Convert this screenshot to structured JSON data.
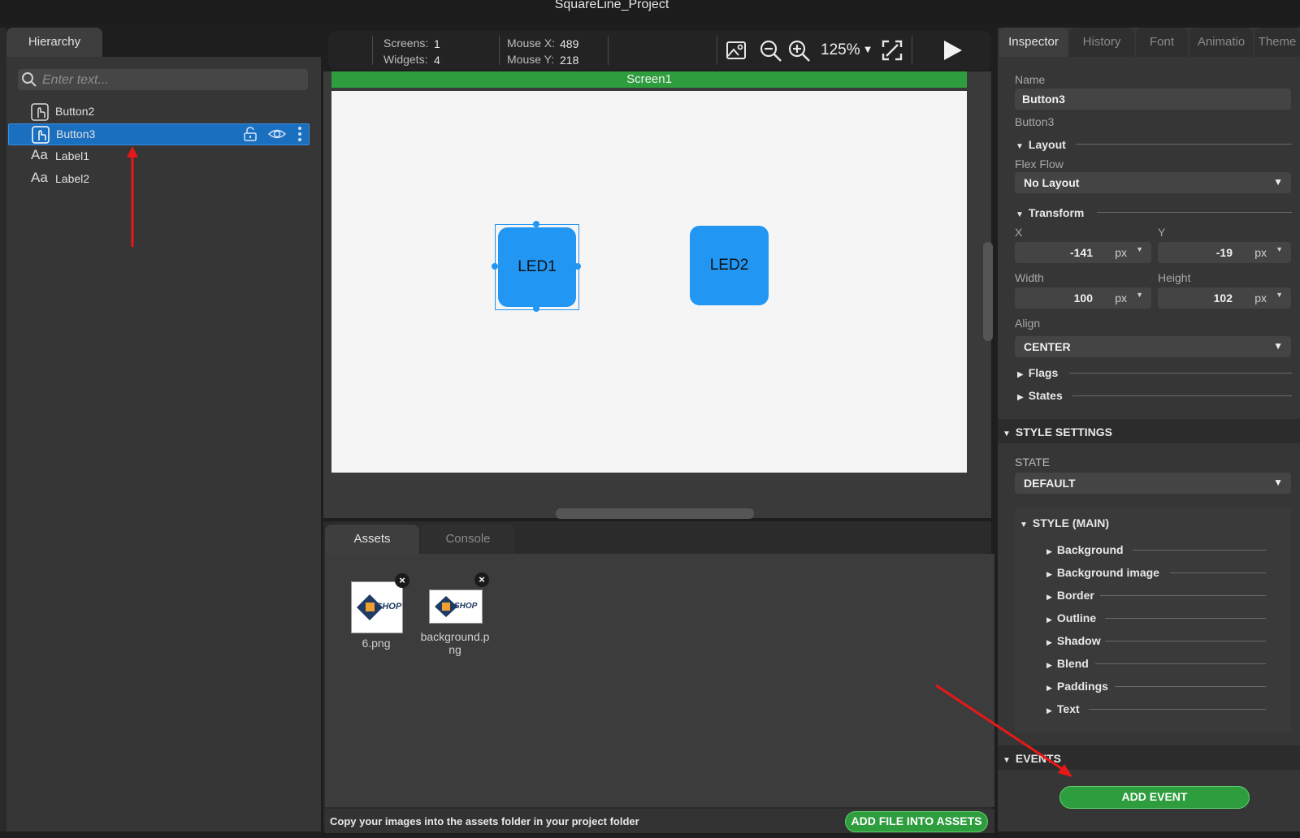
{
  "window": {
    "title": "SquareLine_Project"
  },
  "hierarchy": {
    "tab_label": "Hierarchy",
    "search_placeholder": "Enter text...",
    "items": [
      {
        "label": "Button2",
        "type": "button"
      },
      {
        "label": "Button3",
        "type": "button",
        "selected": true
      },
      {
        "label": "Label1",
        "type": "label"
      },
      {
        "label": "Label2",
        "type": "label"
      }
    ],
    "label_glyph": "Aa"
  },
  "toolbar": {
    "screens_label": "Screens:",
    "screens_value": "1",
    "widgets_label": "Widgets:",
    "widgets_value": "4",
    "mousex_label": "Mouse X:",
    "mousex_value": "489",
    "mousey_label": "Mouse Y:",
    "mousey_value": "218",
    "zoom": "125%"
  },
  "canvas": {
    "screen_name": "Screen1",
    "buttons": [
      {
        "label": "LED1"
      },
      {
        "label": "LED2"
      }
    ]
  },
  "assets": {
    "tabs": [
      {
        "label": "Assets",
        "active": true
      },
      {
        "label": "Console",
        "active": false
      }
    ],
    "items": [
      {
        "name": "6.png"
      },
      {
        "name": "background.p ng"
      }
    ],
    "thumb_text": "SHOP",
    "footer_message": "Copy your images into the assets folder in your project folder",
    "add_file_label": "ADD FILE INTO ASSETS"
  },
  "inspector": {
    "tabs": [
      "Inspector",
      "History",
      "Font",
      "Animatio",
      "Theme"
    ],
    "name_label": "Name",
    "name_value": "Button3",
    "type_label": "Button3",
    "layout": {
      "title": "Layout",
      "flex_flow_label": "Flex Flow",
      "flex_flow_value": "No Layout"
    },
    "transform": {
      "title": "Transform",
      "x_label": "X",
      "x_value": "-141",
      "x_unit": "px",
      "y_label": "Y",
      "y_value": "-19",
      "y_unit": "px",
      "width_label": "Width",
      "width_value": "100",
      "width_unit": "px",
      "height_label": "Height",
      "height_value": "102",
      "height_unit": "px",
      "align_label": "Align",
      "align_value": "CENTER"
    },
    "flags_label": "Flags",
    "states_label": "States",
    "style_settings": {
      "title": "STYLE SETTINGS",
      "state_label": "STATE",
      "state_value": "DEFAULT",
      "style_main_title": "STYLE (MAIN)",
      "items": [
        "Background",
        "Background image",
        "Border",
        "Outline",
        "Shadow",
        "Blend",
        "Paddings",
        "Text"
      ]
    },
    "events": {
      "title": "EVENTS",
      "add_label": "ADD EVENT"
    }
  },
  "colors": {
    "accent": "#2196f3",
    "green": "#2e9d3e",
    "selection": "#1a6fbf",
    "annotation": "#e81818"
  }
}
